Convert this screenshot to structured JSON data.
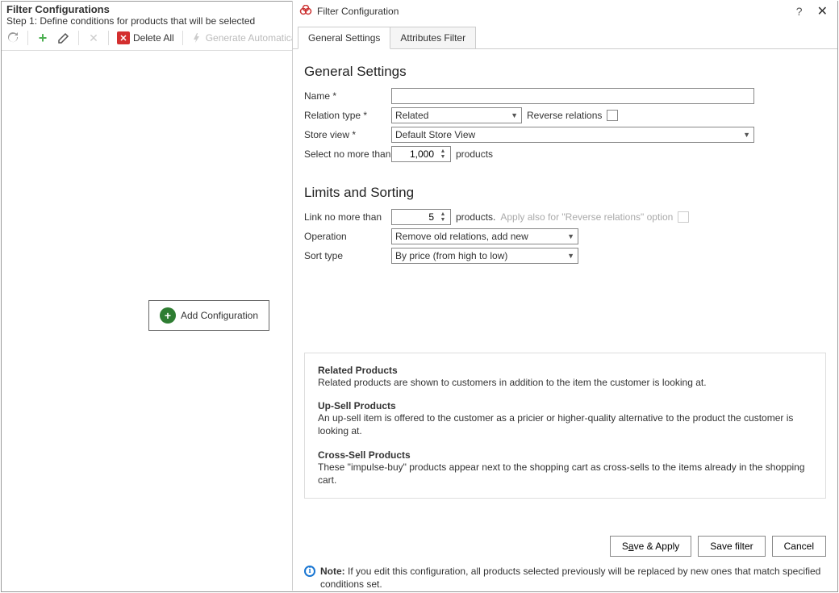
{
  "header": {
    "title": "Filter Configurations",
    "subtitle": "Step 1: Define conditions for products that will be selected"
  },
  "toolbar": {
    "delete_all": "Delete All",
    "generate_auto": "Generate Automatically"
  },
  "add_config_label": "Add Configuration",
  "dialog": {
    "title": "Filter Configuration",
    "tabs": {
      "general": "General Settings",
      "attributes": "Attributes Filter"
    },
    "section_general": "General Settings",
    "section_limits": "Limits and Sorting",
    "labels": {
      "name": "Name *",
      "relation_type": "Relation type *",
      "reverse": "Reverse relations",
      "store_view": "Store view *",
      "select_no_more": "Select no more than",
      "products": "products",
      "link_no_more": "Link no more than",
      "products_dot": "products.",
      "apply_also": "Apply also for \"Reverse relations\" option",
      "operation": "Operation",
      "sort_type": "Sort type"
    },
    "values": {
      "name": "",
      "relation_type": "Related",
      "store_view": "Default Store View",
      "select_limit": "1,000",
      "link_limit": "5",
      "operation": "Remove old relations, add new",
      "sort_type": "By price (from high to low)"
    },
    "info": {
      "related_t": "Related Products",
      "related_d": "Related products are shown to customers in addition to the item the customer is looking at.",
      "upsell_t": "Up-Sell Products",
      "upsell_d": "An up-sell item is offered to the customer as a pricier or higher-quality alternative to the product the customer is looking at.",
      "cross_t": "Cross-Sell Products",
      "cross_d": "These \"impulse-buy\" products appear next to the shopping cart as cross-sells to the items already in the shopping cart."
    },
    "buttons": {
      "save_apply_pre": "S",
      "save_apply_u": "a",
      "save_apply_post": "ve & Apply",
      "save_filter": "Save filter",
      "cancel": "Cancel"
    },
    "note_label": "Note:",
    "note_text": "If you edit this configuration, all products selected previously will be replaced by new ones that match specified conditions set."
  }
}
